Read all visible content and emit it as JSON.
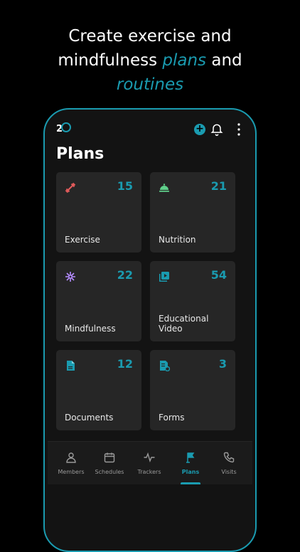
{
  "headline": {
    "line1": "Create exercise and",
    "line2_prefix": "mindfulness ",
    "line2_accent": "plans",
    "line2_suffix": " and",
    "line3_accent": "routines"
  },
  "app": {
    "logo_text": "2",
    "title": "Plans"
  },
  "plans": [
    {
      "label": "Exercise",
      "count": "15",
      "icon": "dumbbell-icon",
      "color": "#e05a5a"
    },
    {
      "label": "Nutrition",
      "count": "21",
      "icon": "cloche-icon",
      "color": "#5fcf8a"
    },
    {
      "label": "Mindfulness",
      "count": "22",
      "icon": "mandala-icon",
      "color": "#b58cff"
    },
    {
      "label": "Educational Video",
      "count": "54",
      "icon": "video-library-icon",
      "color": "#1a9bb0"
    },
    {
      "label": "Documents",
      "count": "12",
      "icon": "document-icon",
      "color": "#1a9bb0"
    },
    {
      "label": "Forms",
      "count": "3",
      "icon": "form-icon",
      "color": "#1a9bb0"
    }
  ],
  "tabs": [
    {
      "label": "Members",
      "icon": "person-icon"
    },
    {
      "label": "Schedules",
      "icon": "calendar-icon"
    },
    {
      "label": "Trackers",
      "icon": "pulse-icon"
    },
    {
      "label": "Plans",
      "icon": "flag-icon",
      "active": true
    },
    {
      "label": "Visits",
      "icon": "phone-icon"
    }
  ],
  "accent_color": "#1a9bb0"
}
